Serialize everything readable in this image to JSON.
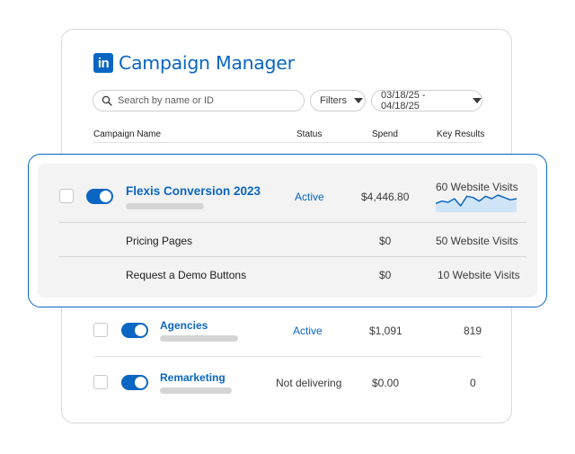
{
  "brand": {
    "logo_text": "in",
    "title": "Campaign Manager"
  },
  "toolbar": {
    "search_placeholder": "Search by name or ID",
    "filters_label": "Filters",
    "date_range": "03/18/25 - 04/18/25"
  },
  "table": {
    "headers": [
      "Campaign Name",
      "Status",
      "Spend",
      "Key Results"
    ]
  },
  "highlighted": {
    "campaign": {
      "name": "Flexis Conversion 2023",
      "status": "Active",
      "spend": "$4,446.80",
      "key_results": "60 Website Visits"
    },
    "sparkline": [
      3,
      4,
      3.5,
      5,
      2,
      6,
      5.5,
      4,
      6,
      5,
      6.5,
      5.5,
      4.5,
      5
    ],
    "sub_rows": [
      {
        "name": "Pricing Pages",
        "spend": "$0",
        "key_results": "50 Website Visits"
      },
      {
        "name": "Request a Demo Buttons",
        "spend": "$0",
        "key_results": "10 Website Visits"
      }
    ]
  },
  "rows": [
    {
      "name": "Agencies",
      "status": "Active",
      "spend": "$1,091",
      "key_results": "819"
    },
    {
      "name": "Remarketing",
      "status": "Not delivering",
      "spend": "$0.00",
      "key_results": "0"
    }
  ],
  "colors": {
    "accent": "#0a66c2",
    "panel_bg": "#f3f3f3",
    "sparkline_fill": "#cfe4f7"
  }
}
